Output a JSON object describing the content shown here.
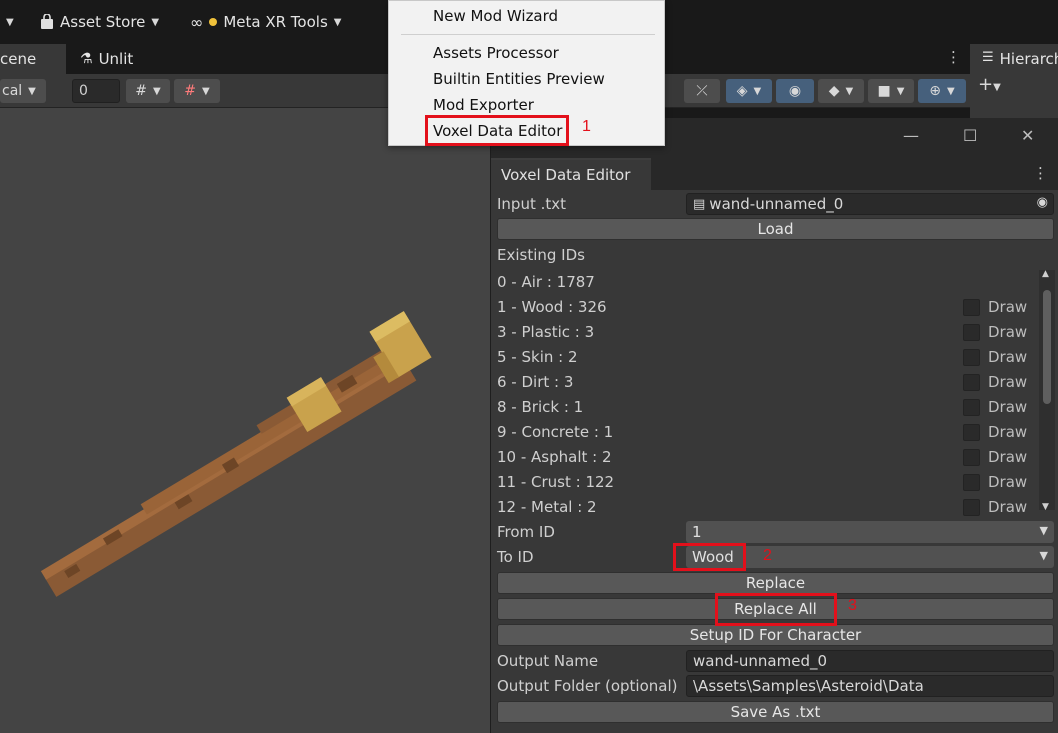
{
  "topbar": {
    "asset_store": "Asset Store",
    "meta_xr": "Meta XR Tools"
  },
  "scene": {
    "tab_scene": "cene",
    "tab_unlit": "Unlit",
    "local_label": "cal",
    "snap_value": "0"
  },
  "hierarchy": {
    "title": "Hierarch"
  },
  "menu": {
    "items": [
      "New Mod Wizard",
      "Assets Processor",
      "Builtin Entities Preview",
      "Mod Exporter",
      "Voxel Data Editor"
    ]
  },
  "window": {
    "tab_title": "Voxel Data Editor",
    "input_label": "Input .txt",
    "input_value": "wand-unnamed_0",
    "load_button": "Load",
    "existing_label": "Existing IDs",
    "ids": [
      "0 - Air : 1787",
      "1 - Wood : 326",
      "3 - Plastic : 3",
      "5 - Skin : 2",
      "6 - Dirt : 3",
      "8 - Brick : 1",
      "9 - Concrete : 1",
      "10 - Asphalt : 2",
      "11 - Crust : 122",
      "12 - Metal : 2"
    ],
    "draw_label": "Draw",
    "from_label": "From ID",
    "from_value": "1",
    "to_label": "To ID",
    "to_value": "Wood",
    "replace_button": "Replace",
    "replace_all_button": "Replace All",
    "setup_button": "Setup ID For Character",
    "output_name_label": "Output Name",
    "output_name_value": "wand-unnamed_0",
    "output_folder_label": "Output Folder (optional)",
    "output_folder_value": "\\Assets\\Samples\\Asteroid\\Data",
    "save_button": "Save As .txt"
  },
  "annotations": [
    "1",
    "2",
    "3"
  ],
  "colors": {
    "highlight": "#e3101b",
    "wood": "#8a5a35",
    "wood_light": "#a36b3e",
    "gold": "#c9a24c"
  }
}
